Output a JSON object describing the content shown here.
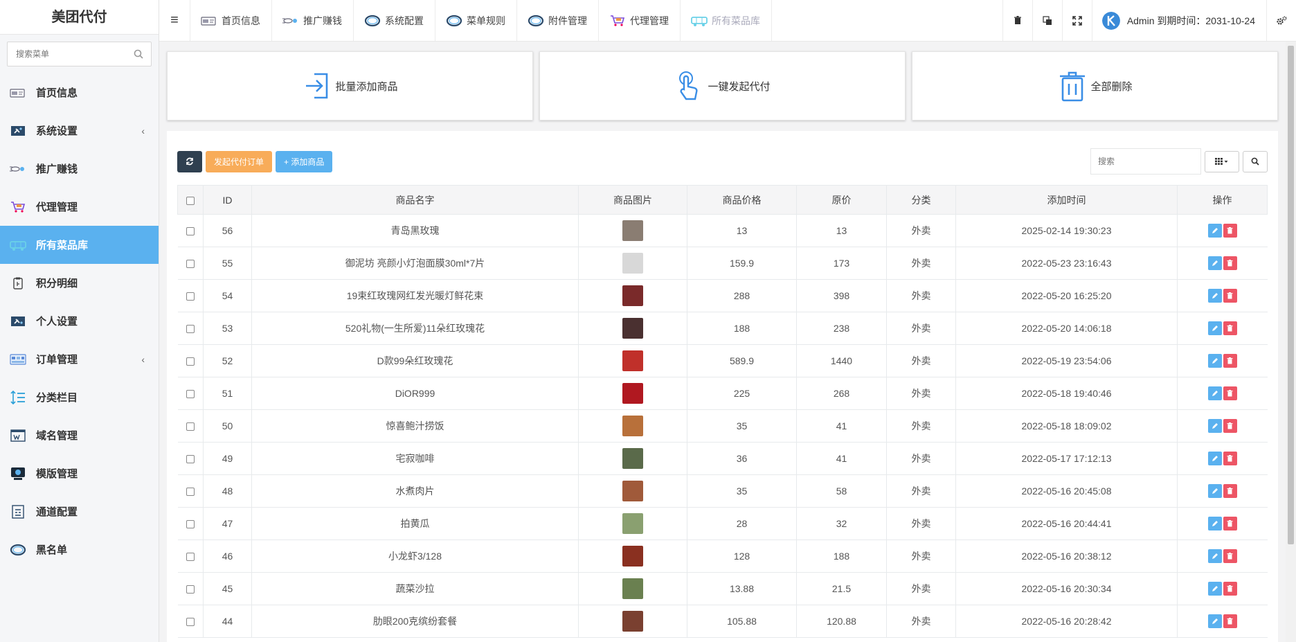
{
  "brand": "美团代付",
  "sidebar": {
    "search_placeholder": "搜索菜单",
    "items": [
      {
        "label": "首页信息",
        "icon": "home-card-icon",
        "active": false,
        "submenu": false
      },
      {
        "label": "系统设置",
        "icon": "settings-icon",
        "active": false,
        "submenu": true
      },
      {
        "label": "推广赚钱",
        "icon": "promote-icon",
        "active": false,
        "submenu": false
      },
      {
        "label": "代理管理",
        "icon": "cart-icon",
        "active": false,
        "submenu": false
      },
      {
        "label": "所有菜品库",
        "icon": "truck-icon",
        "active": true,
        "submenu": false
      },
      {
        "label": "积分明细",
        "icon": "points-icon",
        "active": false,
        "submenu": false
      },
      {
        "label": "个人设置",
        "icon": "profile-settings-icon",
        "active": false,
        "submenu": false
      },
      {
        "label": "订单管理",
        "icon": "order-icon",
        "active": false,
        "submenu": true
      },
      {
        "label": "分类栏目",
        "icon": "category-icon",
        "active": false,
        "submenu": false
      },
      {
        "label": "域名管理",
        "icon": "domain-icon",
        "active": false,
        "submenu": false
      },
      {
        "label": "模版管理",
        "icon": "template-icon",
        "active": false,
        "submenu": false
      },
      {
        "label": "通道配置",
        "icon": "channel-icon",
        "active": false,
        "submenu": false
      },
      {
        "label": "黑名单",
        "icon": "ring-icon",
        "active": false,
        "submenu": false
      }
    ],
    "submenu_chevron": "‹"
  },
  "topbar": {
    "tabs": [
      {
        "label": "首页信息",
        "icon": "home-card-icon"
      },
      {
        "label": "推广赚钱",
        "icon": "promote-icon"
      },
      {
        "label": "系统配置",
        "icon": "ring-icon"
      },
      {
        "label": "菜单规则",
        "icon": "ring-icon"
      },
      {
        "label": "附件管理",
        "icon": "ring-icon"
      },
      {
        "label": "代理管理",
        "icon": "cart-icon"
      },
      {
        "label": "所有菜品库",
        "icon": "truck-icon"
      }
    ],
    "user_text": "Admin 到期时间：2031-10-24"
  },
  "cards": [
    {
      "label": "批量添加商品",
      "icon": "import-icon"
    },
    {
      "label": "一键发起代付",
      "icon": "tap-hand-icon"
    },
    {
      "label": "全部删除",
      "icon": "trash-icon"
    }
  ],
  "toolbar": {
    "create_order_label": "发起代付订单",
    "add_product_label": "+ 添加商品",
    "search_placeholder": "搜索"
  },
  "table": {
    "columns": [
      "ID",
      "商品名字",
      "商品图片",
      "商品价格",
      "原价",
      "分类",
      "添加时间",
      "操作"
    ],
    "rows": [
      {
        "id": "56",
        "name": "青岛黑玫瑰",
        "price": "13",
        "orig": "13",
        "cat": "外卖",
        "time": "2025-02-14 19:30:23",
        "img": "#8a7d72"
      },
      {
        "id": "55",
        "name": "御泥坊 亮颜小灯泡面膜30ml*7片",
        "price": "159.9",
        "orig": "173",
        "cat": "外卖",
        "time": "2022-05-23 23:16:43",
        "img": "#d8d8d8"
      },
      {
        "id": "54",
        "name": "19束红玫瑰网红发光暖灯鲜花束",
        "price": "288",
        "orig": "398",
        "cat": "外卖",
        "time": "2022-05-20 16:25:20",
        "img": "#7a2a2a"
      },
      {
        "id": "53",
        "name": "520礼物(一生所爱)11朵红玫瑰花",
        "price": "188",
        "orig": "238",
        "cat": "外卖",
        "time": "2022-05-20 14:06:18",
        "img": "#4a3030"
      },
      {
        "id": "52",
        "name": "D款99朵红玫瑰花",
        "price": "589.9",
        "orig": "1440",
        "cat": "外卖",
        "time": "2022-05-19 23:54:06",
        "img": "#c0302a"
      },
      {
        "id": "51",
        "name": "DiOR999",
        "price": "225",
        "orig": "268",
        "cat": "外卖",
        "time": "2022-05-18 19:40:46",
        "img": "#b01820"
      },
      {
        "id": "50",
        "name": "惊喜鲍汁捞饭",
        "price": "35",
        "orig": "41",
        "cat": "外卖",
        "time": "2022-05-18 18:09:02",
        "img": "#b8703a"
      },
      {
        "id": "49",
        "name": "宅寂咖啡",
        "price": "36",
        "orig": "41",
        "cat": "外卖",
        "time": "2022-05-17 17:12:13",
        "img": "#5a6a4a"
      },
      {
        "id": "48",
        "name": "水煮肉片",
        "price": "35",
        "orig": "58",
        "cat": "外卖",
        "time": "2022-05-16 20:45:08",
        "img": "#a05a3a"
      },
      {
        "id": "47",
        "name": "拍黄瓜",
        "price": "28",
        "orig": "32",
        "cat": "外卖",
        "time": "2022-05-16 20:44:41",
        "img": "#8aa070"
      },
      {
        "id": "46",
        "name": "小龙虾3/128",
        "price": "128",
        "orig": "188",
        "cat": "外卖",
        "time": "2022-05-16 20:38:12",
        "img": "#8a3020"
      },
      {
        "id": "45",
        "name": "蔬菜沙拉",
        "price": "13.88",
        "orig": "21.5",
        "cat": "外卖",
        "time": "2022-05-16 20:30:34",
        "img": "#6a8050"
      },
      {
        "id": "44",
        "name": "肋眼200克缤纷套餐",
        "price": "105.88",
        "orig": "120.88",
        "cat": "外卖",
        "time": "2022-05-16 20:28:42",
        "img": "#7a4030"
      }
    ]
  },
  "colors": {
    "accent": "#5ab1ef",
    "dark": "#2f4050",
    "orange": "#f8ac59",
    "danger": "#ed5565"
  }
}
